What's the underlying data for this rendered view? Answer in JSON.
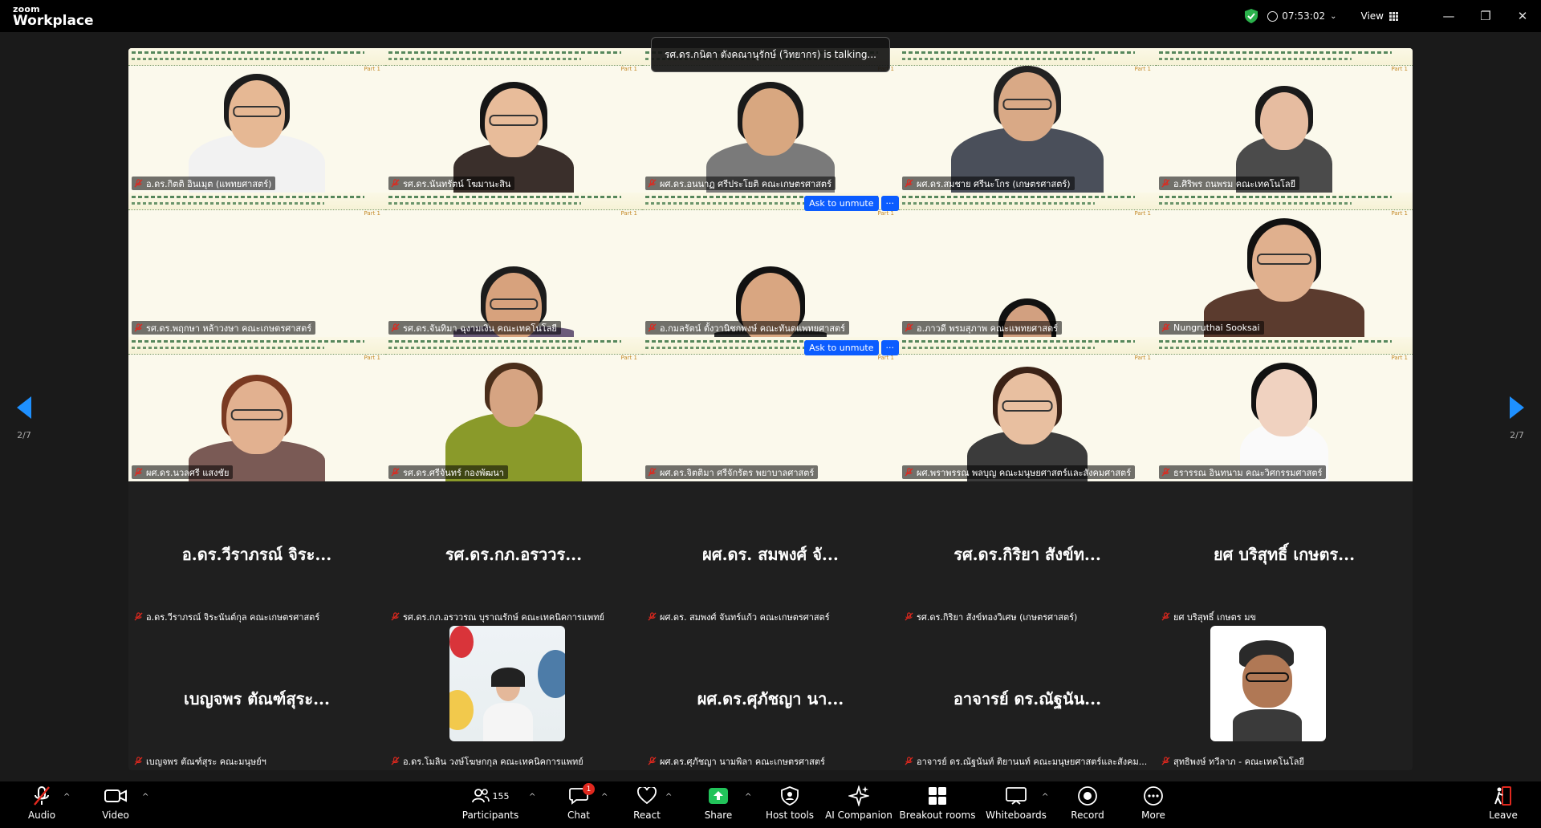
{
  "titlebar": {
    "brand_small": "zoom",
    "brand_large": "Workplace",
    "timer": "07:53:02",
    "view_label": "View"
  },
  "speaker_banner": "รศ.ดร.กนิตา ตังคณานุรักษ์ (วิทยากร) is talking...",
  "ask_to_unmute": "Ask to unmute",
  "more_label": "···",
  "part_label": "Part 1",
  "pager": {
    "left": "2/7",
    "right": "2/7"
  },
  "tiles": [
    {
      "name": "อ.ดร.กิตติ อินเมุต (แพทยศาสตร์)"
    },
    {
      "name": "รศ.ดร.นันทรัตน์ โฆมานะสิน"
    },
    {
      "name": "ผศ.ดร.อนนาฏ ศรีประโยติ คณะเกษตรศาสตร์"
    },
    {
      "name": "ผศ.ดร.สมชาย ศรีนะโกร (เกษตรศาสตร์)"
    },
    {
      "name": "อ.ศิริพร ถนพรม คณะเทคโนโลยี"
    },
    {
      "name": "รศ.ดร.พฤกษา หล้าวงษา คณะเกษตรศาสตร์"
    },
    {
      "name": "รศ.ดร.จันทิมา ฉุงามเงิน คณะเทคโนโลยี"
    },
    {
      "name": "อ.กมลรัตน์ ตั้งวานิชกพงษ์ คณะทันตแพทยศาสตร์"
    },
    {
      "name": "อ.ภาวดี พรมสุภาพ คณะแพทยศาสตร์"
    },
    {
      "name": "Nungruthai Sooksai"
    },
    {
      "name": "ผศ.ดร.นวลศรี แสงชัย"
    },
    {
      "name": "รศ.ดร.ศรีจันทร์ กองพัฒนา"
    },
    {
      "name": "ผศ.ดร.จิตติมา ศรีจักรัตร พยาบาลศาสตร์"
    },
    {
      "name": "ผศ.พราพรรณ พลบุญ คณะมนุษยศาสตร์และสังคมศาสตร์"
    },
    {
      "name": "ธรารรณ อินทนาม คณะวิศกรรมศาสตร์"
    },
    {
      "display": "อ.ดร.วีราภรณ์ จิระ...",
      "name": "อ.ดร.วีราภรณ์ จิระนันต์กุล คณะเกษตรศาสตร์"
    },
    {
      "display": "รศ.ดร.กภ.อรววร...",
      "name": "รศ.ดร.กภ.อรววรณ บุราณรักษ์ คณะเทคนิคการแพทย์"
    },
    {
      "display": "ผศ.ดร. สมพงศ์ จั...",
      "name": "ผศ.ดร. สมพงศ์ จันทร์แก้ว คณะเกษตรศาสตร์"
    },
    {
      "display": "รศ.ดร.กิริยา สังข์ท...",
      "name": "รศ.ดร.กิริยา สังข์ทองวิเศษ (เกษตรศาสตร์)"
    },
    {
      "display": "ยศ บริสุทธิ์ เกษตร...",
      "name": "ยศ บริสุทธิ์ เกษตร มข"
    },
    {
      "display": "เบญจพร ตัณฑ์สุระ...",
      "name": "เบญจพร ตัณฑ์สุระ คณะมนุษย์ฯ"
    },
    {
      "name": "อ.ดร.โมลิน วงษ์โฆษกกุล คณะเทคนิคการแพทย์"
    },
    {
      "display": "ผศ.ดร.ศุภัชญา นา...",
      "name": "ผศ.ดร.ศุภัชญา นามพิลา คณะเกษตรศาสตร์"
    },
    {
      "display": "อาจารย์ ดร.ณัฐนัน...",
      "name": "อาจารย์ ดร.ณัฐนันท์ ติยานนท์ คณะมนุษยศาสตร์และสังคม..."
    },
    {
      "name": "สุทธิพงษ์ ทวีลาภ - คณะเทคโนโลยี"
    }
  ],
  "toolbar": {
    "audio": "Audio",
    "video": "Video",
    "participants": "Participants",
    "participants_count": "155",
    "chat": "Chat",
    "chat_badge": "1",
    "react": "React",
    "share": "Share",
    "host_tools": "Host tools",
    "ai_companion": "AI Companion",
    "breakout": "Breakout rooms",
    "whiteboards": "Whiteboards",
    "record": "Record",
    "more": "More",
    "leave": "Leave"
  },
  "colors": {
    "accent": "#0b5cff",
    "share_green": "#22c35a",
    "leave_red": "#e0281e",
    "shield_green": "#2bb24c"
  }
}
